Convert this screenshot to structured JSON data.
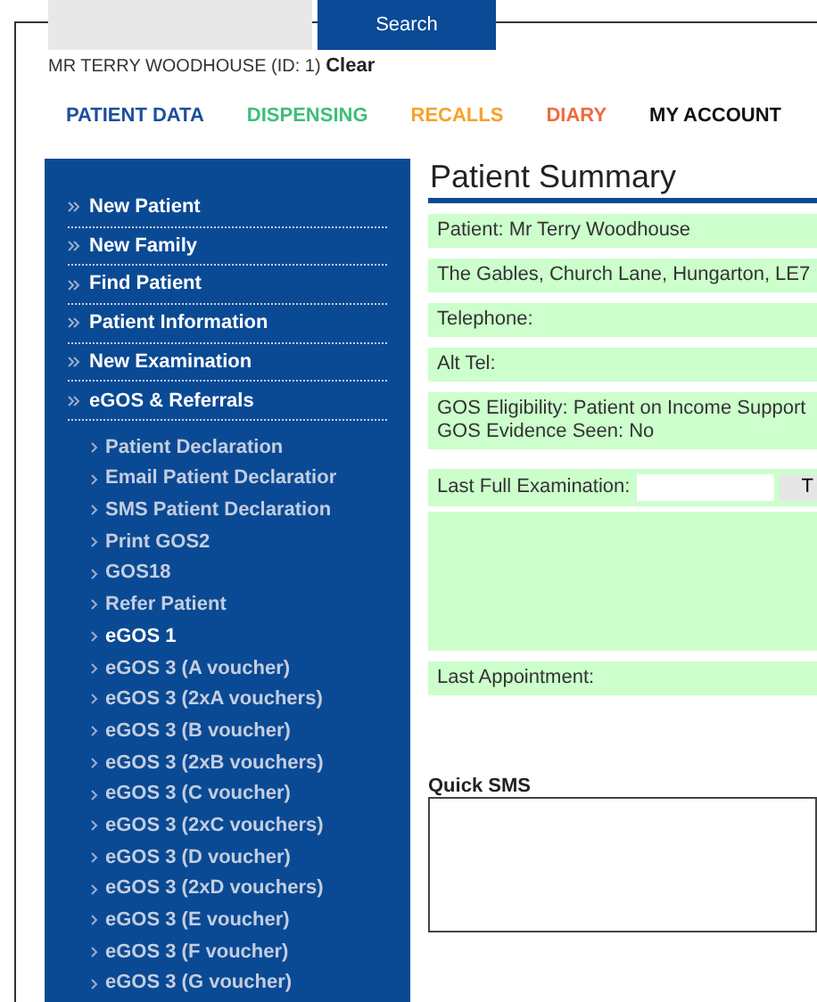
{
  "search": {
    "button": "Search"
  },
  "patient_bar": {
    "name": "MR TERRY WOODHOUSE (ID: 1)",
    "clear": "Clear"
  },
  "nav": [
    {
      "label": "PATIENT DATA",
      "color": "#1b4f9c"
    },
    {
      "label": "DISPENSING",
      "color": "#3dbf78"
    },
    {
      "label": "RECALLS",
      "color": "#f7a22a"
    },
    {
      "label": "DIARY",
      "color": "#ef6b3d"
    },
    {
      "label": "MY ACCOUNT",
      "color": "#111111"
    }
  ],
  "sidebar": {
    "items": [
      {
        "label": "New Patient"
      },
      {
        "label": "New Family"
      },
      {
        "label": "Find Patient"
      },
      {
        "label": "Patient Information"
      },
      {
        "label": "New Examination"
      },
      {
        "label": "eGOS & Referrals",
        "children": [
          {
            "label": "Patient Declaration",
            "selected": false
          },
          {
            "label": "Email Patient Declaratior",
            "selected": false
          },
          {
            "label": "SMS Patient Declaration",
            "selected": false
          },
          {
            "label": "Print GOS2",
            "selected": false
          },
          {
            "label": "GOS18",
            "selected": false
          },
          {
            "label": "Refer Patient",
            "selected": false
          },
          {
            "label": "eGOS 1",
            "selected": true
          },
          {
            "label": "eGOS 3 (A voucher)",
            "selected": false
          },
          {
            "label": "eGOS 3 (2xA vouchers)",
            "selected": false
          },
          {
            "label": "eGOS 3 (B voucher)",
            "selected": false
          },
          {
            "label": "eGOS 3 (2xB vouchers)",
            "selected": false
          },
          {
            "label": "eGOS 3 (C voucher)",
            "selected": false
          },
          {
            "label": "eGOS 3 (2xC vouchers)",
            "selected": false
          },
          {
            "label": "eGOS 3 (D voucher)",
            "selected": false
          },
          {
            "label": "eGOS 3 (2xD vouchers)",
            "selected": false
          },
          {
            "label": "eGOS 3 (E voucher)",
            "selected": false
          },
          {
            "label": "eGOS 3 (F voucher)",
            "selected": false
          },
          {
            "label": "eGOS 3 (G voucher)",
            "selected": false
          }
        ]
      }
    ]
  },
  "summary": {
    "title": "Patient Summary",
    "rows": [
      {
        "kind": "text",
        "lines": [
          "Patient: Mr Terry Woodhouse"
        ]
      },
      {
        "kind": "text",
        "lines": [
          "The Gables, Church Lane, Hungarton, LE7"
        ]
      },
      {
        "kind": "text",
        "lines": [
          "Telephone:"
        ]
      },
      {
        "kind": "text",
        "lines": [
          "Alt Tel:"
        ]
      },
      {
        "kind": "text",
        "lines": [
          "GOS Eligibility: Patient on Income Support",
          "GOS Evidence Seen: No"
        ]
      },
      {
        "kind": "gap"
      },
      {
        "kind": "field",
        "label": "Last Full Examination:",
        "button": "T"
      },
      {
        "kind": "block"
      },
      {
        "kind": "text",
        "lines": [
          "Last Appointment:"
        ]
      }
    ]
  },
  "quick_sms": {
    "label": "Quick SMS"
  }
}
